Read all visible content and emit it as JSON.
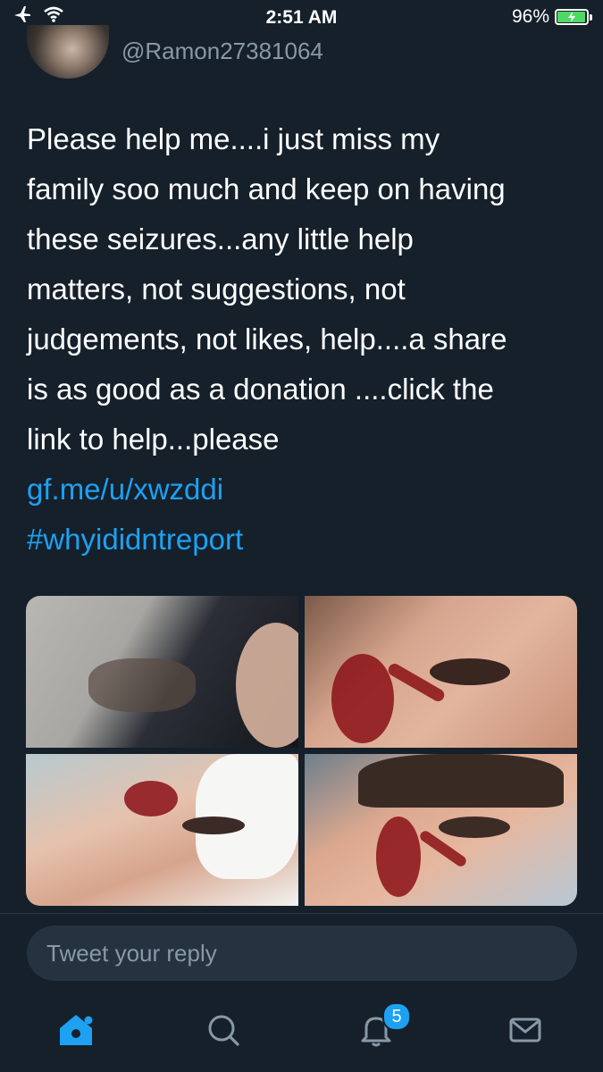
{
  "status_bar": {
    "time": "2:51 AM",
    "battery_percent": "96%",
    "battery_level": 0.96,
    "icons": [
      "airplane-icon",
      "wifi-icon",
      "battery-charging-icon"
    ]
  },
  "tweet": {
    "handle": "@Ramon27381064",
    "text_lines": [
      "Please help me....i just miss my",
      "family soo much and keep on having",
      "these seizures...any little help",
      "matters, not suggestions, not",
      "judgements, not likes, help....a share",
      "is as good as a donation ....click the",
      "link to help...please"
    ],
    "link": "gf.me/u/xwzddi",
    "hashtag": "#whyididntreport"
  },
  "reply": {
    "placeholder": "Tweet your reply"
  },
  "tab_bar": {
    "notifications_badge": "5"
  },
  "colors": {
    "background": "#15202b",
    "accent": "#1da1f2",
    "secondary_text": "#8899a6",
    "reply_box": "#253341"
  }
}
